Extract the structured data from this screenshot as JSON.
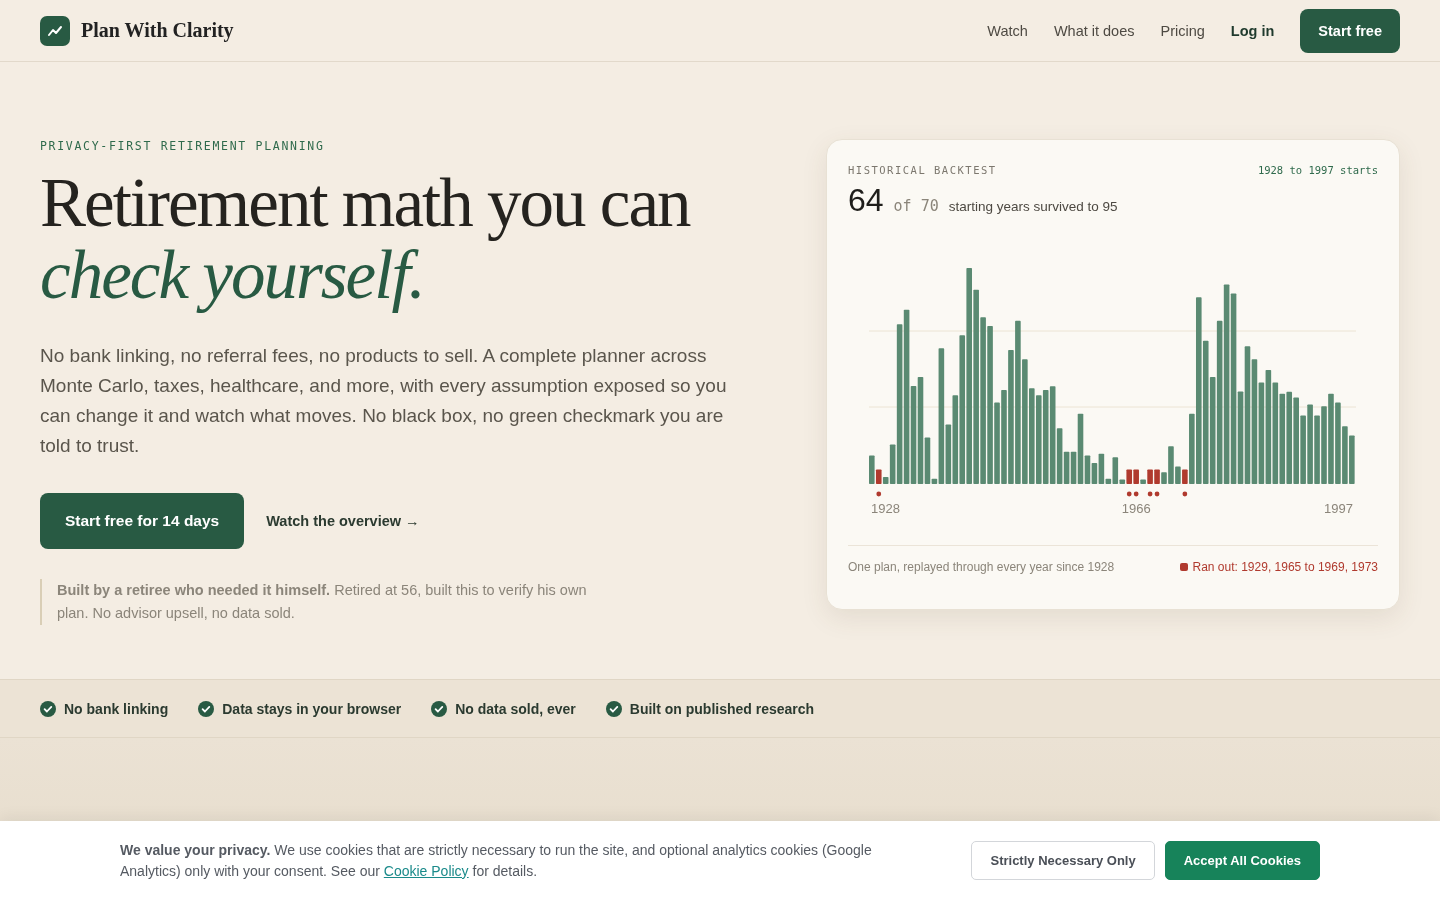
{
  "header": {
    "brand": "Plan With Clarity",
    "nav": [
      {
        "label": "Watch",
        "kind": "link"
      },
      {
        "label": "What it does",
        "kind": "link"
      },
      {
        "label": "Pricing",
        "kind": "link"
      },
      {
        "label": "Log in",
        "kind": "strong"
      }
    ],
    "cta": "Start free"
  },
  "hero": {
    "eyebrow": "PRIVACY-FIRST RETIREMENT PLANNING",
    "headline": "Retirement math you can *check yourself.*",
    "lead": "No bank linking, no referral fees, no products to sell. A complete planner across Monte Carlo, taxes, healthcare, and more, with every assumption exposed so you can change it and watch what moves. No black box, no green checkmark you are told to trust.",
    "primary_button": "Start free for 14 days",
    "secondary_link": "Watch the overview →",
    "note": "**Built by a retiree who needed it himself.** Retired at 56, built this to verify his own plan. No advisor upsell, no data sold."
  },
  "backtest": {
    "label": "HISTORICAL BACKTEST",
    "range": "1928 to 1997 starts",
    "count": "64",
    "of": "of 70",
    "caption": "starting years survived to 95",
    "axis_labels": [
      "1928",
      "1966",
      "1997"
    ],
    "footnote": "One plan, replayed through every year since 1928",
    "legend": "Ran out: 1929, 1965 to 1969, 1973"
  },
  "trust": [
    "No bank linking",
    "Data stays in your browser",
    "No data sold, ever",
    "Built on published research"
  ],
  "cookies": {
    "text_before": "**We value your privacy.** We use cookies that are strictly necessary to run the site, and optional analytics cookies (Google Analytics) only with your consent. See our ",
    "link": "Cookie Policy",
    "text_after": " for details.",
    "buttons": [
      {
        "label": "Strictly Necessary Only",
        "kind": "secondary"
      },
      {
        "label": "Accept All Cookies",
        "kind": "primary"
      }
    ]
  }
}
